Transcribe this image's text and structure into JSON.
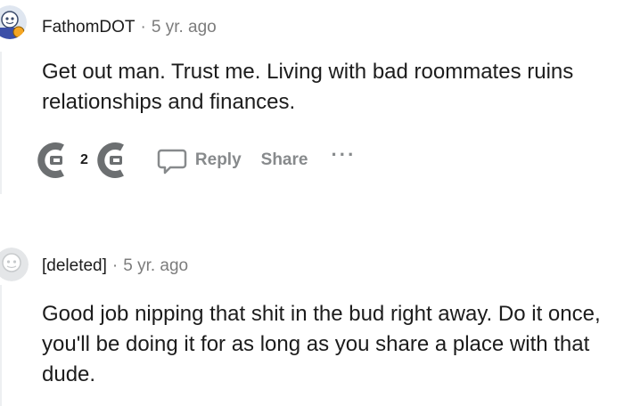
{
  "comments": [
    {
      "author": "FathomDOT",
      "separator": "·",
      "time": "5 yr. ago",
      "text": "Get out man. Trust me. Living with bad roommates ruins relationships and finances.",
      "score": "2",
      "actions": {
        "reply": "Reply",
        "share": "Share",
        "more": "···"
      }
    },
    {
      "author": "[deleted]",
      "separator": "·",
      "time": "5 yr. ago",
      "text": "Good job nipping that shit in the bud right away. Do it once, you'll be doing it for as long as you share a place with that dude."
    }
  ],
  "icons": {
    "upvote": "upvote-icon",
    "downvote": "downvote-icon",
    "reply": "reply-bubble-icon",
    "more": "more-options-icon",
    "avatar_1": "snoo-avatar-icon",
    "avatar_2": "deleted-user-avatar-icon"
  },
  "colors": {
    "vote_gray": "#6c6f71",
    "meta_gray": "#7c7c7c",
    "action_gray": "#878a8c",
    "text": "#1c1c1c",
    "thread_line": "#edeff1"
  }
}
